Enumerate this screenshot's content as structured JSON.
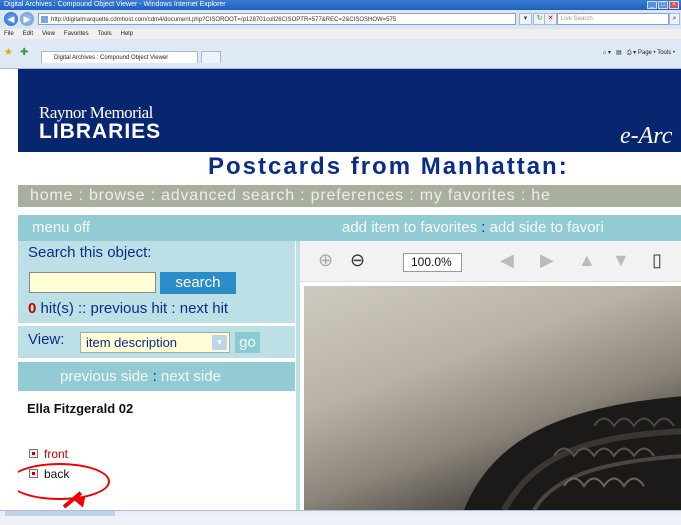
{
  "window": {
    "title": "Digital Archives : Compound Object Viewer - Windows Internet Explorer"
  },
  "addressbar": {
    "url": "http://digitalmarquette.cdmhost.com/cdm4/document.php?CISOROOT=/p128701coll26CISOPTR=577&REC=2&CISOSHOW=575",
    "search_placeholder": "Live Search"
  },
  "menubar": [
    "File",
    "Edit",
    "View",
    "Favorites",
    "Tools",
    "Help"
  ],
  "tab": {
    "label": "Digital Archives : Compound Object Viewer"
  },
  "toolbar_right": "Page •  Tools •",
  "banner": {
    "logo_line1": "Raynor Memorial",
    "logo_line2": "LIBRARIES",
    "right_text": "e-Arc"
  },
  "page_title": "Postcards from Manhattan:",
  "nav": "home : browse : advanced search : preferences : my favorites : he",
  "tools": {
    "menu_off": "menu off",
    "add_item": "add item to favorites",
    "sep": ":",
    "add_side": "add side to favori"
  },
  "search": {
    "label": "Search this object:",
    "input_value": "",
    "button": "search",
    "hits_count": "0",
    "hits_text": "hit(s) :: previous hit : next hit"
  },
  "view": {
    "label": "View:",
    "selected": "item description",
    "go": "go"
  },
  "sides": {
    "previous": "previous side",
    "sep": ":",
    "next": "next side"
  },
  "item": {
    "title": "Ella Fitzgerald 02",
    "pages": [
      "front",
      "back"
    ]
  },
  "viewer": {
    "zoom": "100.0%"
  },
  "colors": {
    "banner": "#07266f",
    "title_blue": "#0b2d87",
    "nav_bar": "#a8b09d",
    "tool_bar": "#92cbd3",
    "panel": "#bde0e6",
    "link_red": "#c00000",
    "annotation": "#ee0000"
  }
}
